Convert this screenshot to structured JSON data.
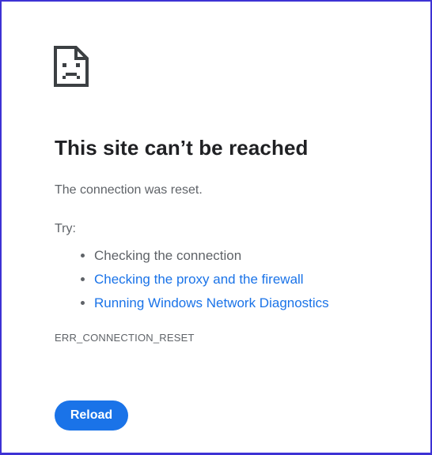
{
  "error": {
    "icon": "sad-page-icon",
    "title": "This site can’t be reached",
    "message": "The connection was reset.",
    "try_label": "Try:",
    "suggestions": [
      {
        "label": "Checking the connection",
        "link": false
      },
      {
        "label": "Checking the proxy and the firewall",
        "link": true
      },
      {
        "label": "Running Windows Network Diagnostics",
        "link": true
      }
    ],
    "code": "ERR_CONNECTION_RESET",
    "reload_label": "Reload"
  },
  "colors": {
    "accent": "#1a73e8",
    "title": "#202124",
    "body_text": "#5f6368",
    "frame_border": "#3d32d4"
  }
}
